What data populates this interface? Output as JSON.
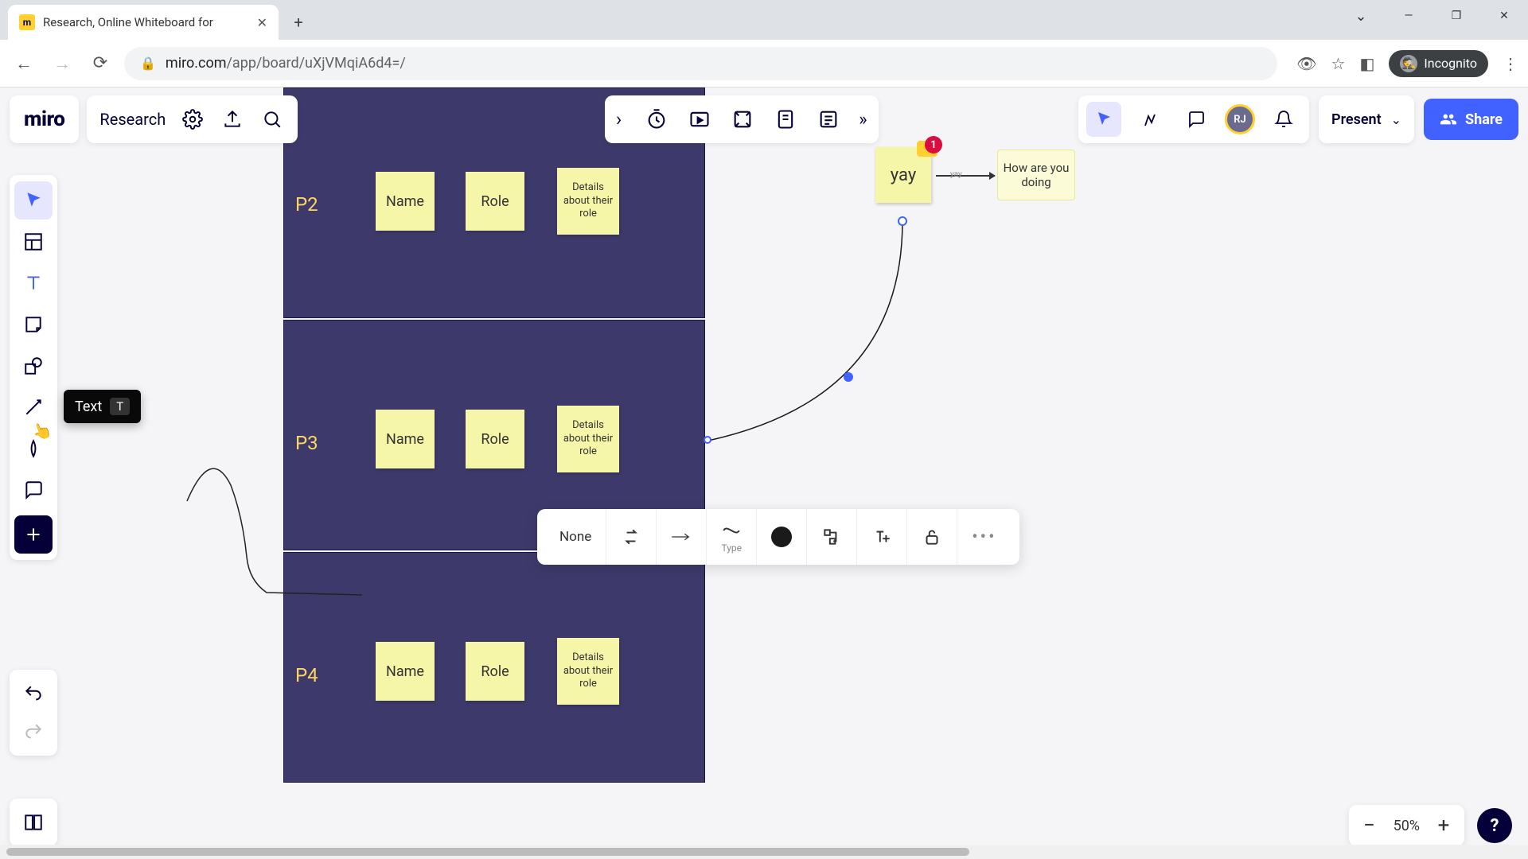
{
  "browser": {
    "tab_title": "Research, Online Whiteboard for",
    "url_domain": "miro.com",
    "url_path": "/app/board/uXjVMqiA6d4=/",
    "incognito_label": "Incognito"
  },
  "header": {
    "logo": "miro",
    "board_name": "Research",
    "present_label": "Present",
    "share_label": "Share",
    "avatar_initials": "RJ",
    "notification_count": "1"
  },
  "toolbar_tooltip": {
    "label": "Text",
    "shortcut": "T"
  },
  "rows": [
    {
      "label": "P2",
      "name": "Name",
      "role": "Role",
      "details": "Details about their role"
    },
    {
      "label": "P3",
      "name": "Name",
      "role": "Role",
      "details": "Details about their role"
    },
    {
      "label": "P4",
      "name": "Name",
      "role": "Role",
      "details": "Details about their role"
    }
  ],
  "notes": {
    "yay": "yay",
    "yay_badge": "1",
    "arrow_label": "yay",
    "how": "How are you doing"
  },
  "ctx": {
    "start": "None",
    "type_label": "Type"
  },
  "zoom": {
    "value": "50%"
  }
}
